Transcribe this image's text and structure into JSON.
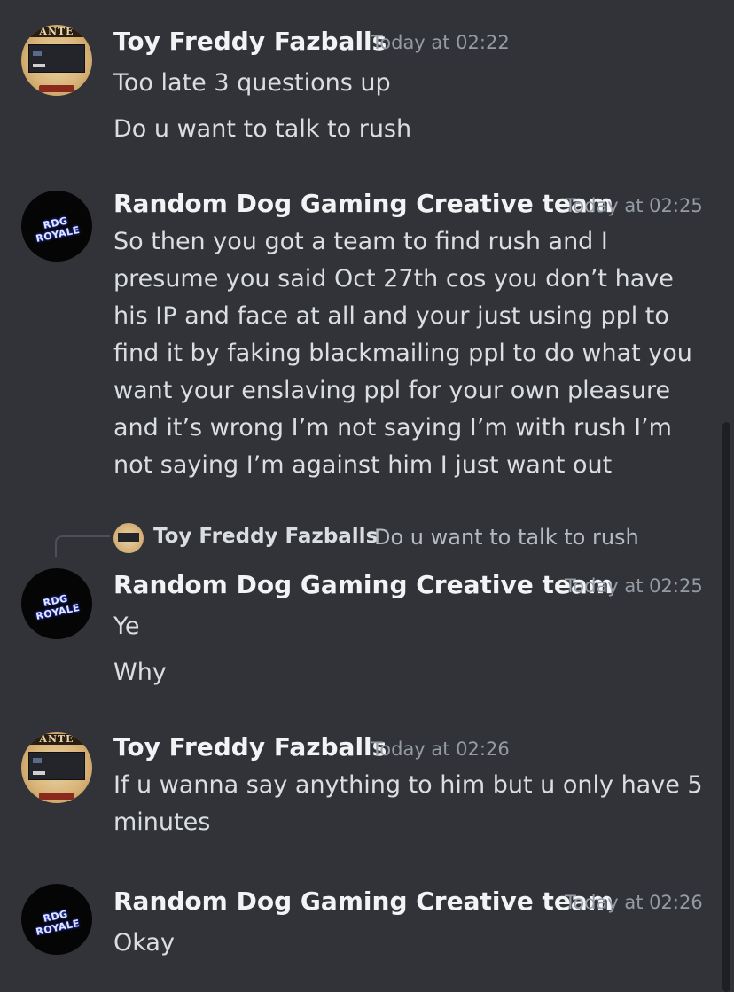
{
  "messages": [
    {
      "author": "Toy Freddy Fazballs",
      "time": "Today at 02:22",
      "lines": [
        "Too late 3 questions up",
        "Do u want to talk to rush"
      ]
    },
    {
      "author": "Random Dog Gaming Creative team",
      "time": "Today at 02:25",
      "lines": [
        "So then you got a team to find rush and I presume you said Oct 27th cos you don’t have his IP and face at all and your just using ppl to find it by faking blackmailing ppl to do what you want your enslaving ppl for your own pleasure and it’s wrong I’m not saying I’m with rush I’m not saying I’m against him I just want out"
      ]
    },
    {
      "reply": {
        "author": "Toy Freddy Fazballs",
        "text": "Do u want to talk to rush"
      },
      "author": "Random Dog Gaming Creative team",
      "time": "Today at 02:25",
      "lines": [
        "Ye",
        "Why"
      ]
    },
    {
      "author": "Toy Freddy Fazballs",
      "time": "Today at 02:26",
      "lines": [
        "If u wanna say anything to him but u only have 5 minutes"
      ]
    },
    {
      "author": "Random Dog Gaming Creative team",
      "time": "Today at 02:26",
      "lines": [
        "Okay"
      ]
    }
  ],
  "avatars": {
    "freddy_poster_text": "ANTE",
    "rdg_logo_text": "RDG ROYALE"
  },
  "colors": {
    "background": "#313338",
    "username": "#f2f3f5",
    "message_text": "#dbdee1",
    "timestamp": "#949ba4"
  }
}
